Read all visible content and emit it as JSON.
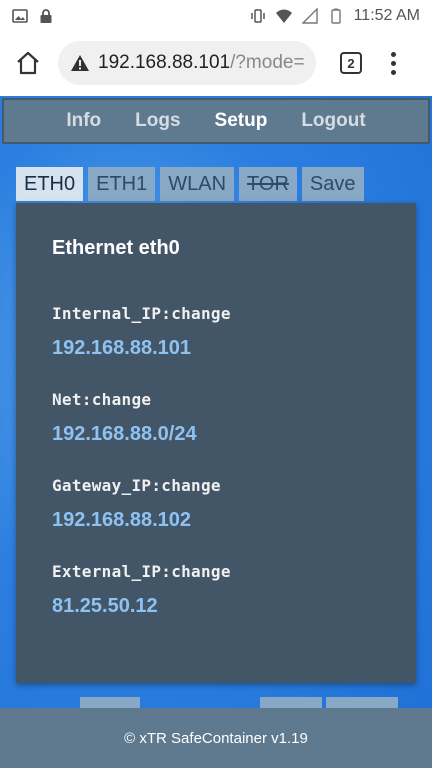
{
  "statusbar": {
    "time": "11:52 AM",
    "icons": [
      "image-icon",
      "lock-icon",
      "vibrate-icon",
      "wifi-icon",
      "signal-icon",
      "battery-icon"
    ]
  },
  "browser": {
    "url_main": "192.168.88.101",
    "url_rest": "/?mode=",
    "tab_count": "2"
  },
  "nav": {
    "items": [
      "Info",
      "Logs",
      "Setup",
      "Logout"
    ],
    "active": "Setup"
  },
  "tabs": [
    "ETH0",
    "ETH1",
    "WLAN",
    "TOR",
    "Save"
  ],
  "card": {
    "title": "Ethernet eth0",
    "fields": [
      {
        "label": "Internal_IP:change",
        "value": "192.168.88.101"
      },
      {
        "label": "Net:change",
        "value": "192.168.88.0/24"
      },
      {
        "label": "Gateway_IP:change",
        "value": "192.168.88.102"
      },
      {
        "label": "External_IP:change",
        "value": "81.25.50.12"
      }
    ]
  },
  "footer": {
    "text": "©  xTR SafeContainer v1.19"
  },
  "colors": {
    "nav_bg": "#5f7a8e",
    "card_bg": "#435667",
    "value_text": "#8ec2f2",
    "page_bg": "#2c7fe0"
  }
}
